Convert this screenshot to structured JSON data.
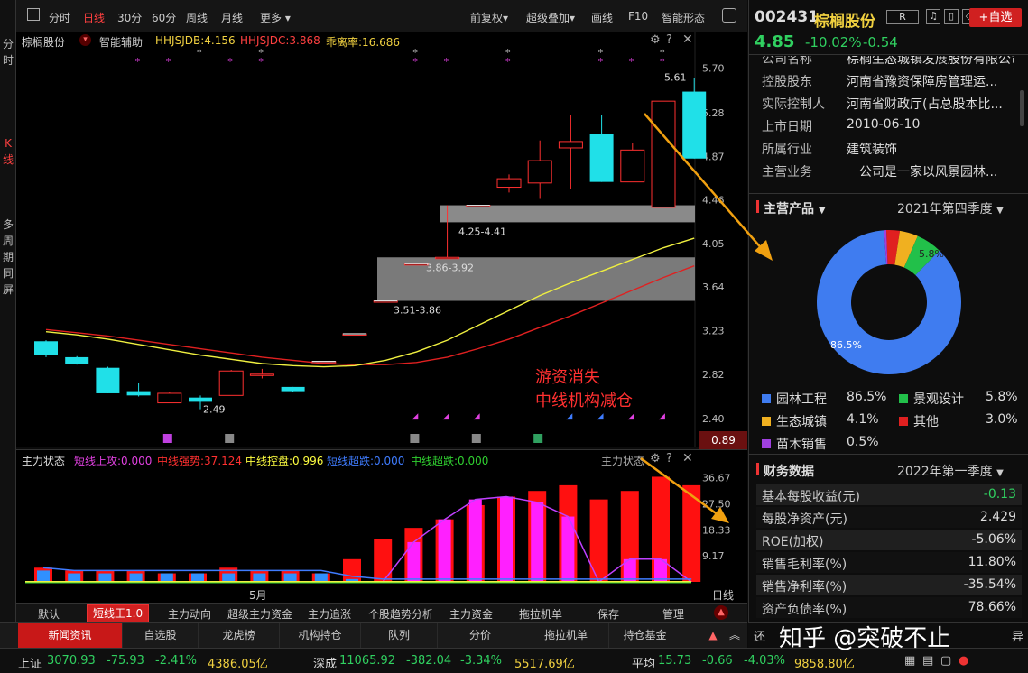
{
  "left_sidebar": [
    "分时",
    "K线",
    "多周期同屏"
  ],
  "toolbar": {
    "items": [
      "分时",
      "日线",
      "30分",
      "60分",
      "周线",
      "月线",
      "更多"
    ],
    "active": "日线",
    "right_items": [
      "前复权",
      "超级叠加",
      "画线",
      "F10",
      "智能形态"
    ]
  },
  "chart_header": {
    "name": "棕榈股份",
    "assist": "智能辅助",
    "hhjsjdb": "HHJSJDB:4.156",
    "hhjsjdc": "HHJSJDC:3.868",
    "deviation": "乖离率:16.686"
  },
  "price_axis": [
    "5.70",
    "5.28",
    "4.87",
    "4.46",
    "4.05",
    "3.64",
    "3.23",
    "2.82",
    "2.40"
  ],
  "current_price_tag": "0.89",
  "annotations": {
    "high": "5.61",
    "low": "2.49",
    "zone1": "4.25-4.41",
    "zone2": "3.86-3.92",
    "zone3": "3.51-3.86",
    "note_line1": "游资消失",
    "note_line2": "中线机构减仓"
  },
  "chart_data": {
    "type": "candlestick",
    "candles": [
      {
        "o": 3.13,
        "c": 3.0,
        "h": 3.14,
        "l": 2.98
      },
      {
        "o": 2.98,
        "c": 2.92,
        "h": 2.99,
        "l": 2.91
      },
      {
        "o": 2.88,
        "c": 2.64,
        "h": 2.89,
        "l": 2.64
      },
      {
        "o": 2.66,
        "c": 2.62,
        "h": 2.74,
        "l": 2.61
      },
      {
        "o": 2.55,
        "c": 2.64,
        "h": 2.65,
        "l": 2.55
      },
      {
        "o": 2.6,
        "c": 2.56,
        "h": 2.62,
        "l": 2.49
      },
      {
        "o": 2.62,
        "c": 2.85,
        "h": 2.86,
        "l": 2.62
      },
      {
        "o": 2.82,
        "c": 2.82,
        "h": 2.87,
        "l": 2.78
      },
      {
        "o": 2.7,
        "c": 2.66,
        "h": 2.7,
        "l": 2.65
      },
      {
        "o": 2.94,
        "c": 2.94,
        "h": 2.94,
        "l": 2.94
      },
      {
        "o": 3.2,
        "c": 3.2,
        "h": 3.2,
        "l": 3.2
      },
      {
        "o": 3.51,
        "c": 3.51,
        "h": 3.51,
        "l": 3.51
      },
      {
        "o": 3.86,
        "c": 3.86,
        "h": 3.86,
        "l": 3.86
      },
      {
        "o": 3.92,
        "c": 3.92,
        "h": 4.41,
        "l": 3.92
      },
      {
        "o": 4.41,
        "c": 4.41,
        "h": 4.41,
        "l": 4.41
      },
      {
        "o": 4.58,
        "c": 4.66,
        "h": 4.7,
        "l": 4.53
      },
      {
        "o": 4.62,
        "c": 4.83,
        "h": 5.02,
        "l": 4.47
      },
      {
        "o": 4.95,
        "c": 5.01,
        "h": 5.26,
        "l": 4.56
      },
      {
        "o": 5.08,
        "c": 4.63,
        "h": 5.26,
        "l": 4.63
      },
      {
        "o": 4.63,
        "c": 4.93,
        "h": 5.0,
        "l": 4.63
      },
      {
        "o": 4.39,
        "c": 5.39,
        "h": 5.39,
        "l": 4.39
      },
      {
        "o": 5.48,
        "c": 4.85,
        "h": 5.61,
        "l": 4.85
      }
    ],
    "ma_yellow": [
      3.22,
      3.19,
      3.15,
      3.1,
      3.05,
      3.0,
      2.96,
      2.92,
      2.9,
      2.89,
      2.9,
      2.95,
      3.03,
      3.14,
      3.28,
      3.42,
      3.56,
      3.68,
      3.79,
      3.9,
      4.01,
      4.1
    ],
    "ma_red": [
      3.24,
      3.21,
      3.18,
      3.14,
      3.1,
      3.06,
      3.02,
      2.98,
      2.95,
      2.92,
      2.91,
      2.91,
      2.93,
      2.98,
      3.06,
      3.15,
      3.26,
      3.37,
      3.49,
      3.61,
      3.73,
      3.84
    ],
    "ylim": [
      2.3,
      5.85
    ]
  },
  "volume_panel": {
    "header": "主力状态",
    "indicators": [
      {
        "label": "短线上攻:0.000",
        "color": "#e040e0"
      },
      {
        "label": "中线强势:37.124",
        "color": "#ff3030"
      },
      {
        "label": "中线控盘:0.996",
        "color": "#ffff40"
      },
      {
        "label": "短线超跌:0.000",
        "color": "#3f7cff"
      },
      {
        "label": "中线超跌:0.000",
        "color": "#30d030"
      }
    ],
    "right_label": "主力状态",
    "axis": [
      "36.67",
      "27.50",
      "18.33",
      "9.17"
    ],
    "month_label": "5月",
    "period": "日线",
    "red": [
      5,
      4,
      4,
      4,
      3,
      3,
      5,
      4,
      4,
      3,
      8,
      15,
      19,
      22,
      27,
      30,
      32,
      34,
      29,
      32,
      37,
      34
    ],
    "blue": [
      4,
      3,
      3,
      3,
      3,
      3,
      3,
      3,
      3,
      3,
      1,
      0,
      0,
      0,
      0,
      0,
      0,
      0,
      0,
      0,
      0,
      0
    ],
    "magenta": [
      0,
      0,
      0,
      0,
      0,
      0,
      0,
      0,
      0,
      0,
      0,
      0,
      14,
      22,
      29,
      30,
      28,
      23,
      0,
      8,
      8,
      0
    ]
  },
  "bottom_tabs": [
    "默认",
    "短线王1.0",
    "主力动向",
    "超级主力资金",
    "主力追涨",
    "个股趋势分析",
    "主力资金",
    "拖拉机单",
    "保存",
    "管理"
  ],
  "bottom_active": "短线王1.0",
  "news_tabs": [
    "新闻资讯",
    "自选股",
    "龙虎榜",
    "机构持仓",
    "队列",
    "分价",
    "拖拉机单",
    "持仓基金"
  ],
  "news_active": "新闻资讯",
  "news_right": [
    "还",
    "知乎 @突破不止",
    "异"
  ],
  "status": {
    "sh_label": "上证",
    "sh_val": "3070.93",
    "sh_chg": "-75.93",
    "sh_pct": "-2.41%",
    "sh_amt": "4386.05亿",
    "sz_label": "深成",
    "sz_val": "11065.92",
    "sz_chg": "-382.04",
    "sz_pct": "-3.34%",
    "sz_amt": "5517.69亿",
    "avg_label": "平均",
    "avg_val": "15.73",
    "avg_chg": "-0.66",
    "avg_pct": "-4.03%",
    "avg_amt": "9858.80亿"
  },
  "stock": {
    "code": "002431",
    "name": "棕榈股份",
    "badge": "R",
    "add_btn": "+自选",
    "price": "4.85",
    "pct": "-10.02%",
    "chg": "-0.54"
  },
  "company": [
    {
      "k": "公司名称",
      "v": "棕榈生态城镇发展股份有限公司"
    },
    {
      "k": "控股股东",
      "v": "河南省豫资保障房管理运..."
    },
    {
      "k": "实际控制人",
      "v": "河南省财政厅(占总股本比..."
    },
    {
      "k": "上市日期",
      "v": "2010-06-10"
    },
    {
      "k": "所属行业",
      "v": "建筑装饰"
    },
    {
      "k": "主营业务",
      "v": "公司是一家以风景园林..."
    }
  ],
  "products": {
    "title": "主营产品",
    "period": "2021年第四季度",
    "slices": [
      {
        "name": "园林工程",
        "pct": "86.5%",
        "value": 86.5,
        "color": "#3f7cf0"
      },
      {
        "name": "景观设计",
        "pct": "5.8%",
        "value": 5.8,
        "color": "#22c04a"
      },
      {
        "name": "生态城镇",
        "pct": "4.1%",
        "value": 4.1,
        "color": "#f0b020"
      },
      {
        "name": "其他",
        "pct": "3.0%",
        "value": 3.0,
        "color": "#e02020"
      },
      {
        "name": "苗木销售",
        "pct": "0.5%",
        "value": 0.5,
        "color": "#a040e0"
      }
    ]
  },
  "finance": {
    "title": "财务数据",
    "period": "2022年第一季度",
    "rows": [
      {
        "k": "基本每股收益(元)",
        "v": "-0.13",
        "green": true
      },
      {
        "k": "每股净资产(元)",
        "v": "2.429"
      },
      {
        "k": "ROE(加权)",
        "v": "-5.06%"
      },
      {
        "k": "销售毛利率(%)",
        "v": "11.80%"
      },
      {
        "k": "销售净利率(%)",
        "v": "-35.54%"
      },
      {
        "k": "资产负债率(%)",
        "v": "78.66%"
      }
    ]
  }
}
